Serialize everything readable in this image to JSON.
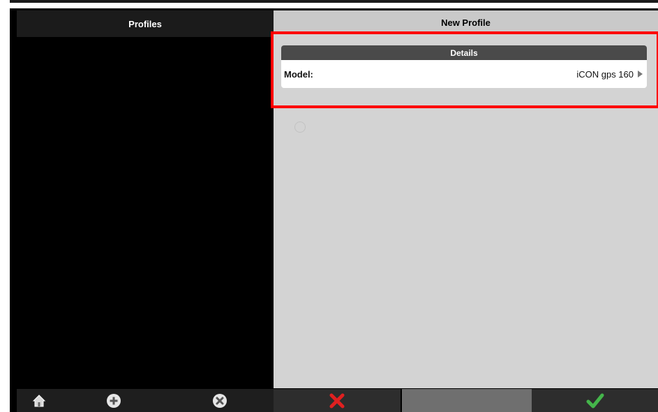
{
  "left_panel": {
    "header": "Profiles"
  },
  "right_panel": {
    "header": "New Profile",
    "details": {
      "title": "Details",
      "model_label": "Model:",
      "model_value": "iCON gps 160"
    }
  },
  "bottom_bar": {
    "buttons": [
      {
        "name": "home",
        "icon": "home-icon"
      },
      {
        "name": "add",
        "icon": "plus-circle-icon"
      },
      {
        "name": "remove",
        "icon": "x-circle-icon"
      },
      {
        "name": "cancel",
        "icon": "red-x-icon"
      },
      {
        "name": "empty",
        "icon": ""
      },
      {
        "name": "confirm",
        "icon": "green-check-icon"
      }
    ]
  },
  "colors": {
    "highlight": "#ff0000",
    "panel_right_bg": "#d3d3d3",
    "details_header_bg": "#4a4a4a",
    "cancel_red": "#e02020",
    "confirm_green": "#44b54a"
  }
}
